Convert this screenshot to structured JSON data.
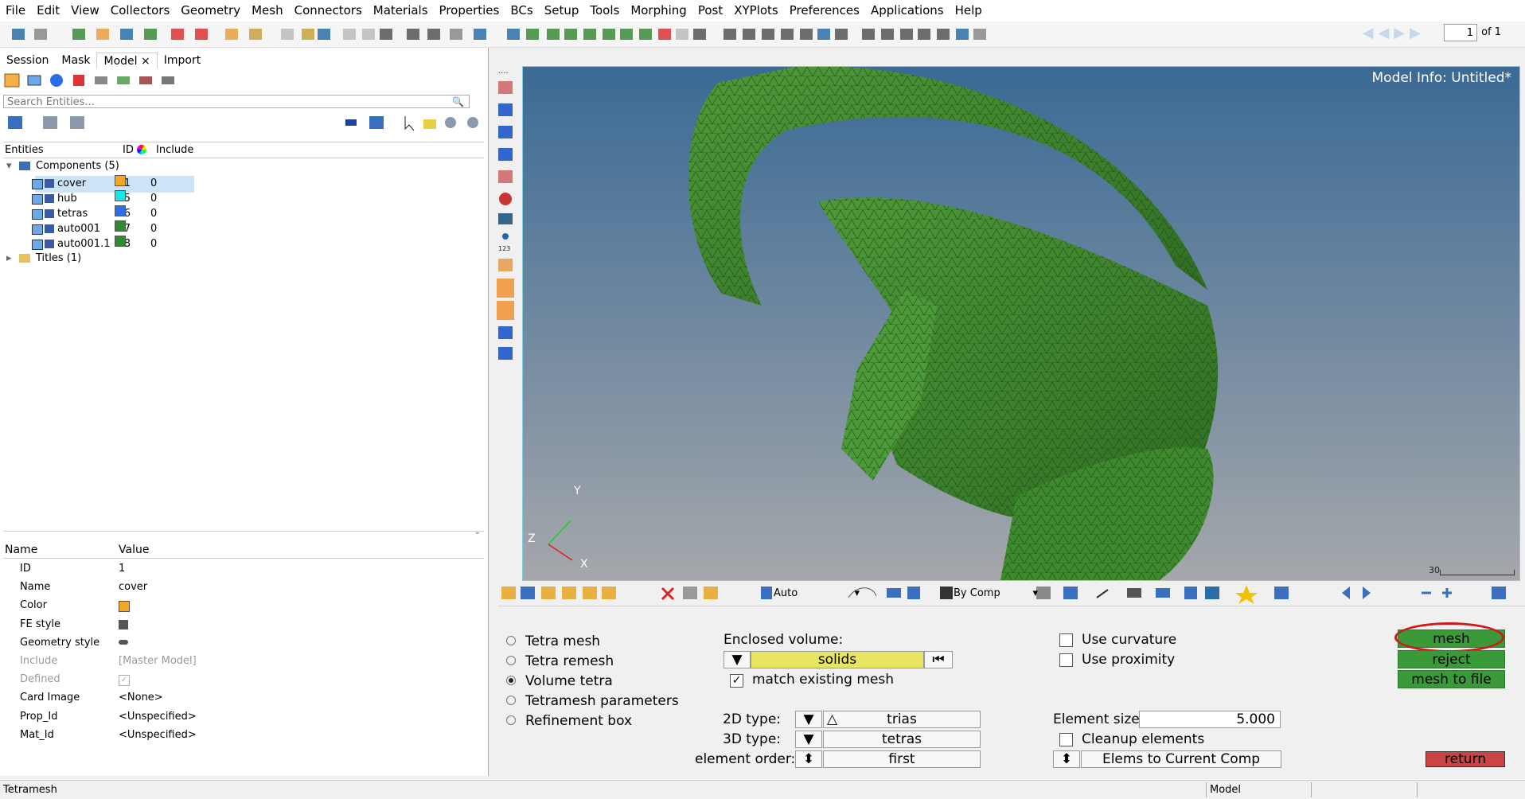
{
  "menu": [
    "File",
    "Edit",
    "View",
    "Collectors",
    "Geometry",
    "Mesh",
    "Connectors",
    "Materials",
    "Properties",
    "BCs",
    "Setup",
    "Tools",
    "Morphing",
    "Post",
    "XYPlots",
    "Preferences",
    "Applications",
    "Help"
  ],
  "pager": {
    "page": "1",
    "of_label": "of 1"
  },
  "browser": {
    "tabs": [
      "Session",
      "Mask",
      "Model",
      "Import"
    ],
    "active_tab": "Model",
    "close_glyph": "×",
    "search_placeholder": "Search Entities...",
    "columns": {
      "entities": "Entities",
      "id": "ID",
      "include": "Include"
    },
    "components_label": "Components (5)",
    "titles_label": "Titles (1)",
    "components": [
      {
        "name": "cover",
        "id": "1",
        "color": "#f5a623",
        "include": "0"
      },
      {
        "name": "hub",
        "id": "15",
        "color": "#17e6e6",
        "include": "0"
      },
      {
        "name": "tetras",
        "id": "16",
        "color": "#2a6ee8",
        "include": "0"
      },
      {
        "name": "auto001",
        "id": "17",
        "color": "#2e8b2e",
        "include": "0"
      },
      {
        "name": "auto001.1",
        "id": "18",
        "color": "#2e8b2e",
        "include": "0"
      }
    ]
  },
  "properties": {
    "header_name": "Name",
    "header_value": "Value",
    "rows": [
      {
        "name": "ID",
        "value": "1"
      },
      {
        "name": "Name",
        "value": "cover"
      },
      {
        "name": "Color",
        "value": ""
      },
      {
        "name": "FE style",
        "value": ""
      },
      {
        "name": "Geometry style",
        "value": ""
      },
      {
        "name": "Include",
        "value": "[Master Model]"
      },
      {
        "name": "Defined",
        "value": ""
      },
      {
        "name": "Card Image",
        "value": "<None>"
      },
      {
        "name": "Prop_Id",
        "value": "<Unspecified>"
      },
      {
        "name": "Mat_Id",
        "value": "<Unspecified>"
      }
    ]
  },
  "viewport": {
    "model_info": "Model Info: Untitled*",
    "triad": {
      "x": "X",
      "y": "Y",
      "z": "Z"
    },
    "scale_label": "30"
  },
  "viewtoolbar": {
    "auto_label": "Auto",
    "bycomp_label": "By Comp"
  },
  "panel": {
    "modes": [
      "Tetra mesh",
      "Tetra remesh",
      "Volume tetra",
      "Tetramesh parameters",
      "Refinement box"
    ],
    "selected_mode": "Volume tetra",
    "enclosed_volume_label": "Enclosed volume:",
    "solids_label": "solids",
    "match_existing_label": "match existing mesh",
    "match_existing_checked": "✓",
    "type2d_label": "2D type:",
    "type2d_value": "trias",
    "type3d_label": "3D type:",
    "type3d_value": "tetras",
    "order_label": "element order:",
    "order_value": "first",
    "use_curvature_label": "Use curvature",
    "use_proximity_label": "Use proximity",
    "element_size_label": "Element size:",
    "element_size_value": "5.000",
    "cleanup_label": "Cleanup elements",
    "elems_to_comp_label": "Elems to Current Comp",
    "mesh_button": "mesh",
    "reject_button": "reject",
    "mesh_to_file_button": "mesh to file",
    "return_button": "return"
  },
  "status": {
    "left": "Tetramesh",
    "model": "Model"
  },
  "colors": {
    "mesh_green": "#3f8a2e",
    "button_green": "#3a9a3a",
    "return_red": "#c94444",
    "highlight_yellow": "#e8e560"
  }
}
